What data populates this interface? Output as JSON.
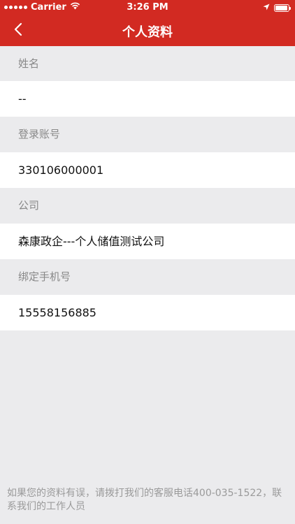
{
  "status_bar": {
    "carrier": "Carrier",
    "time": "3:26 PM"
  },
  "nav": {
    "title": "个人资料"
  },
  "profile": {
    "fields": [
      {
        "label": "姓名",
        "value": "--"
      },
      {
        "label": "登录账号",
        "value": "330106000001"
      },
      {
        "label": "公司",
        "value": "森康政企---个人储值测试公司"
      },
      {
        "label": "绑定手机号",
        "value": "15558156885"
      }
    ]
  },
  "footer": {
    "note": "如果您的资料有误，请拨打我们的客服电话400-035-1522，联系我们的工作人员"
  },
  "colors": {
    "header_bg": "#d22a22",
    "page_bg": "#ebebed",
    "label_text": "#888888",
    "value_text": "#111111"
  },
  "icons": [
    "wifi-icon",
    "location-arrow-icon",
    "battery-icon",
    "back-chevron-icon"
  ]
}
